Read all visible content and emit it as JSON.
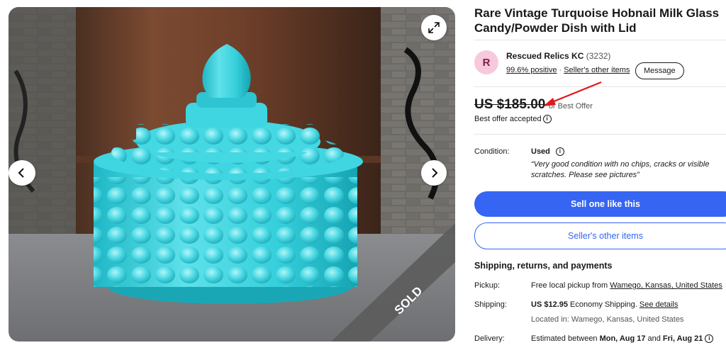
{
  "listing": {
    "title": "Rare Vintage Turquoise Hobnail Milk Glass Candy/Powder Dish with Lid",
    "sold_badge": "SOLD"
  },
  "seller": {
    "avatar_letter": "R",
    "name": "Rescued Relics KC",
    "feedback_count": "(3232)",
    "positive": "99.6% positive",
    "separator": "·",
    "other_items_link": "Seller's other items",
    "message_button": "Message"
  },
  "price": {
    "amount": "US $185.00",
    "best_offer": "or Best Offer",
    "accepted": "Best offer accepted"
  },
  "condition": {
    "label": "Condition:",
    "value": "Used",
    "note": "“Very good condition with no chips, cracks or visible scratches. Please see pictures”"
  },
  "actions": {
    "sell_one": "Sell one like this",
    "other_items": "Seller's other items"
  },
  "shipping": {
    "heading": "Shipping, returns, and payments",
    "pickup_label": "Pickup:",
    "pickup_prefix": "Free local pickup from",
    "pickup_location": "Wamego, Kansas, United States",
    "shipping_label": "Shipping:",
    "shipping_price": "US $12.95",
    "shipping_method": "Economy Shipping.",
    "see_details": "See details",
    "located_in": "Located in: Wamego, Kansas, United States",
    "delivery_label": "Delivery:",
    "delivery_prefix": "Estimated between",
    "delivery_start": "Mon, Aug 17",
    "delivery_and": "and",
    "delivery_end": "Fri, Aug 21"
  },
  "colors": {
    "primary_blue": "#3665f3",
    "dish_turquoise": "#3bd3df",
    "annotation_red": "#e0181c"
  }
}
